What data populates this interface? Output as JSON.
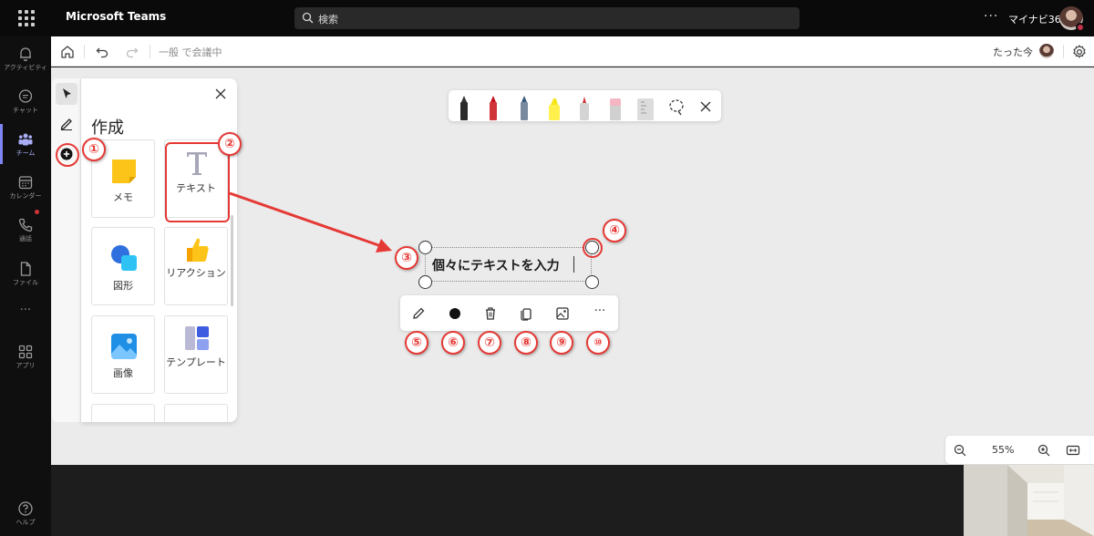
{
  "app": {
    "title": "Microsoft Teams"
  },
  "search": {
    "placeholder": "検索"
  },
  "topbar": {
    "more": "···",
    "org_name": "マイナビ365"
  },
  "rail": {
    "items": [
      {
        "label": "アクティビティ",
        "icon": "bell-icon"
      },
      {
        "label": "チャット",
        "icon": "chat-icon"
      },
      {
        "label": "チーム",
        "icon": "teams-icon"
      },
      {
        "label": "カレンダー",
        "icon": "calendar-icon"
      },
      {
        "label": "通話",
        "icon": "phone-icon"
      },
      {
        "label": "ファイル",
        "icon": "file-icon"
      },
      {
        "label": "アプリ",
        "icon": "apps-icon"
      },
      {
        "label": "ヘルプ",
        "icon": "help-icon"
      }
    ],
    "more": "···"
  },
  "whiteboard": {
    "meeting_status": "一般 で会議中",
    "save_status": "たった今"
  },
  "create_panel": {
    "title": "作成",
    "tiles": [
      {
        "label": "メモ",
        "icon": "sticky-note-icon"
      },
      {
        "label": "テキスト",
        "icon": "text-t-icon"
      },
      {
        "label": "図形",
        "icon": "shapes-icon"
      },
      {
        "label": "リアクション",
        "icon": "thumbs-up-icon"
      },
      {
        "label": "画像",
        "icon": "image-icon"
      },
      {
        "label": "テンプレート",
        "icon": "template-icon"
      }
    ]
  },
  "ink_toolbar": {
    "tools": [
      "black-pen-icon",
      "red-pen-icon",
      "blue-pen-icon",
      "highlighter-icon",
      "arrow-pen-icon",
      "eraser-icon",
      "ruler-icon",
      "lasso-icon",
      "close-icon"
    ]
  },
  "text_object": {
    "content": "個々にテキストを入力"
  },
  "context_toolbar": {
    "tools": [
      "edit-pen-icon",
      "color-dot-icon",
      "delete-icon",
      "copy-icon",
      "image-swap-icon",
      "more-icon"
    ],
    "more_label": "···"
  },
  "zoom": {
    "level": "55%"
  },
  "annotations": [
    "①",
    "②",
    "③",
    "④",
    "⑤",
    "⑥",
    "⑦",
    "⑧",
    "⑨",
    "⑩"
  ],
  "colors": {
    "accent": "#7f85f5",
    "annotation": "#e53935",
    "topbar": "#0a0a0a",
    "canvas": "#ebebeb"
  }
}
